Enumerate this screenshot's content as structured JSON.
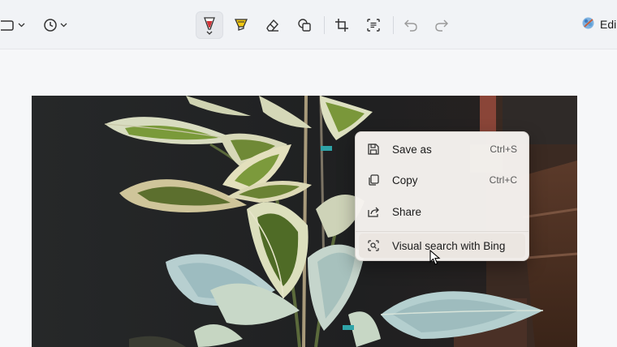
{
  "toolbar": {
    "tools": [
      {
        "name": "rectangle-select",
        "icon": "rectangle-select-icon"
      },
      {
        "name": "timer",
        "icon": "timer-icon"
      },
      {
        "name": "ballpoint-pen",
        "icon": "pen-icon",
        "active": true,
        "color": "#d13438"
      },
      {
        "name": "highlighter",
        "icon": "highlighter-icon",
        "color": "#f2c811"
      },
      {
        "name": "eraser",
        "icon": "eraser-icon"
      },
      {
        "name": "shapes",
        "icon": "shapes-icon"
      },
      {
        "name": "crop",
        "icon": "crop-icon"
      },
      {
        "name": "text-actions",
        "icon": "text-actions-icon"
      },
      {
        "name": "undo",
        "icon": "undo-icon"
      },
      {
        "name": "redo",
        "icon": "redo-icon"
      }
    ],
    "edit_label": "Edi"
  },
  "context_menu": {
    "items": [
      {
        "label": "Save as",
        "shortcut": "Ctrl+S",
        "icon": "save-icon"
      },
      {
        "label": "Copy",
        "shortcut": "Ctrl+C",
        "icon": "copy-icon"
      },
      {
        "label": "Share",
        "shortcut": "",
        "icon": "share-icon"
      },
      {
        "label": "Visual search with Bing",
        "shortcut": "",
        "icon": "visual-search-icon"
      }
    ]
  },
  "colors": {
    "toolbar_bg": "#f1f3f6",
    "menu_bg": "#f6f3f0",
    "photo_bg": "#1f2122",
    "pen_red": "#d13438",
    "highlighter_yellow": "#f2c811"
  }
}
